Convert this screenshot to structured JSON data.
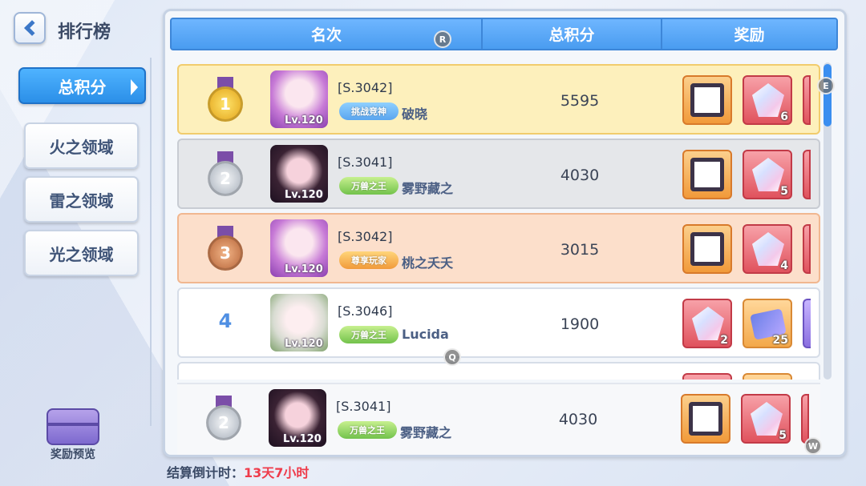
{
  "header": {
    "title": "排行榜"
  },
  "sidebar": {
    "tabs": [
      {
        "label": "总积分",
        "active": true
      },
      {
        "label": "火之领域",
        "active": false
      },
      {
        "label": "雷之领域",
        "active": false
      },
      {
        "label": "光之领域",
        "active": false
      }
    ],
    "reward_preview": "奖励预览"
  },
  "table": {
    "headers": [
      "名次",
      "总积分",
      "奖励"
    ],
    "rows": [
      {
        "rank": "1",
        "medal": "gold",
        "server": "[S.3042]",
        "badge": "挑战竞神",
        "badge_color": "blue",
        "name": "破晓",
        "level": "Lv.120",
        "score": "5595",
        "rewards": [
          {
            "type": "frame",
            "count": ""
          },
          {
            "type": "crystal",
            "count": "6"
          }
        ]
      },
      {
        "rank": "2",
        "medal": "silver",
        "server": "[S.3041]",
        "badge": "万兽之王",
        "badge_color": "green",
        "name": "雾野藏之",
        "level": "Lv.120",
        "score": "4030",
        "rewards": [
          {
            "type": "frame",
            "count": ""
          },
          {
            "type": "crystal",
            "count": "5"
          }
        ]
      },
      {
        "rank": "3",
        "medal": "bronze",
        "server": "[S.3042]",
        "badge": "尊享玩家",
        "badge_color": "orange",
        "name": "桃之夭夭",
        "level": "Lv.120",
        "score": "3015",
        "rewards": [
          {
            "type": "frame",
            "count": ""
          },
          {
            "type": "crystal",
            "count": "4"
          }
        ]
      },
      {
        "rank": "4",
        "medal": "none",
        "server": "[S.3046]",
        "badge": "万兽之王",
        "badge_color": "green",
        "name": "Lucida",
        "level": "Lv.120",
        "score": "1900",
        "rewards": [
          {
            "type": "crystal",
            "count": "2"
          },
          {
            "type": "ticket",
            "count": "25"
          }
        ]
      }
    ]
  },
  "my_rank": {
    "rank": "2",
    "medal": "silver",
    "server": "[S.3041]",
    "badge": "万兽之王",
    "badge_color": "green",
    "name": "雾野藏之",
    "level": "Lv.120",
    "score": "4030",
    "rewards": [
      {
        "type": "frame",
        "count": ""
      },
      {
        "type": "crystal",
        "count": "5"
      }
    ]
  },
  "countdown": {
    "label": "结算倒计时：",
    "value": "13天7小时"
  },
  "hints": [
    "R",
    "E",
    "Q",
    "W"
  ],
  "colors": {
    "accent": "#4a9cf0",
    "countdown": "#ef3b4a"
  }
}
